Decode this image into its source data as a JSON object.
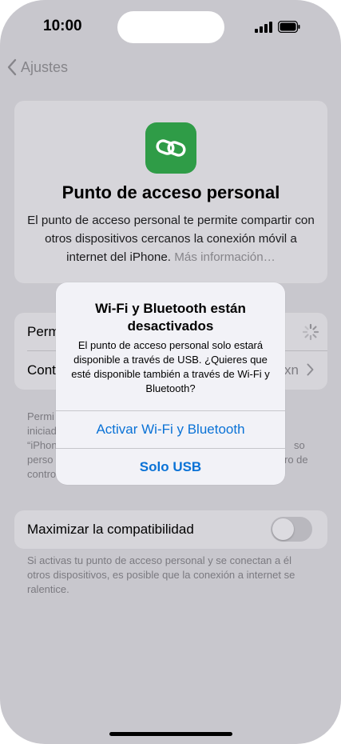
{
  "status_bar": {
    "time": "10:00"
  },
  "nav": {
    "back_label": "Ajustes"
  },
  "hotspot": {
    "title": "Punto de acceso personal",
    "description": "El punto de acceso personal te permite compartir con otros dispositivos cercanos la conexión móvil a internet del iPhone.",
    "more_link": "Más información…"
  },
  "settings_rows": {
    "row1_label": "Perm",
    "row2_label": "Cont",
    "row2_value": "xn"
  },
  "footnote_1": {
    "line1": "Permi",
    "line2": "iniciad",
    "line3": "“iPhon",
    "line3_right": "so",
    "line4": "perso",
    "line4_right": "ro de",
    "line5": "contro"
  },
  "compatibility": {
    "label": "Maximizar la compatibilidad",
    "enabled": false
  },
  "footnote_2": "Si activas tu punto de acceso personal y se conectan a él otros dispositivos, es posible que la conexión a internet se ralentice.",
  "alert": {
    "title": "Wi-Fi y Bluetooth están desactivados",
    "message": "El punto de acceso personal solo estará disponible a través de USB. ¿Quieres que esté disponible también a través de Wi-Fi y Bluetooth?",
    "button_primary": "Activar Wi-Fi y Bluetooth",
    "button_secondary": "Solo USB"
  },
  "colors": {
    "accent": "#0a72d6",
    "hotspot_icon": "#2f9c47",
    "dimmed_background": "#c8c7cd"
  },
  "icons": {
    "back": "chevron-left-icon",
    "hotspot": "link-icon",
    "spinner": "activity-spinner-icon",
    "disclosure": "chevron-right-icon"
  }
}
